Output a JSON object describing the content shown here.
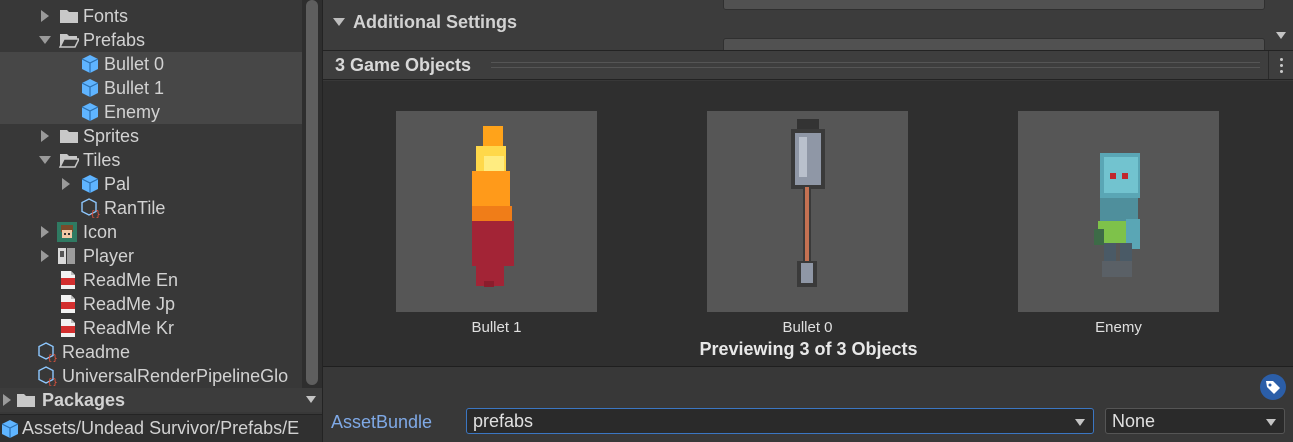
{
  "project": {
    "items": [
      {
        "label": "Fonts",
        "icon": "folder-icon"
      },
      {
        "label": "Prefabs",
        "icon": "folder-open-icon"
      },
      {
        "label": "Bullet 0",
        "icon": "prefab-icon"
      },
      {
        "label": "Bullet 1",
        "icon": "prefab-icon"
      },
      {
        "label": "Enemy",
        "icon": "prefab-icon"
      },
      {
        "label": "Sprites",
        "icon": "folder-icon"
      },
      {
        "label": "Tiles",
        "icon": "folder-open-icon"
      },
      {
        "label": "Pal",
        "icon": "prefab-icon"
      },
      {
        "label": "RanTile",
        "icon": "script-asset-icon"
      },
      {
        "label": "Icon",
        "icon": "sprite-icon"
      },
      {
        "label": "Player",
        "icon": "sprite-sheet-icon"
      },
      {
        "label": "ReadMe En",
        "icon": "pdf-icon"
      },
      {
        "label": "ReadMe Jp",
        "icon": "pdf-icon"
      },
      {
        "label": "ReadMe Kr",
        "icon": "pdf-icon"
      },
      {
        "label": "Readme",
        "icon": "script-asset-icon"
      },
      {
        "label": "UniversalRenderPipelineGlo",
        "icon": "script-asset-icon"
      }
    ],
    "packages_label": "Packages",
    "status_path": "Assets/Undead Survivor/Prefabs/E"
  },
  "inspector": {
    "additional_settings": "Additional Settings",
    "header_title": "3 Game Objects",
    "previews": [
      {
        "name": "Bullet 1"
      },
      {
        "name": "Bullet 0"
      },
      {
        "name": "Enemy"
      }
    ],
    "preview_status": "Previewing 3 of 3 Objects",
    "asset_bundle_label": "AssetBundle",
    "asset_bundle_value": "prefabs",
    "variant_value": "None"
  },
  "colors": {
    "background": "#383838",
    "selection": "#474747",
    "accent": "#3b76c2",
    "asset_bundle_label": "#7fa9e6"
  }
}
